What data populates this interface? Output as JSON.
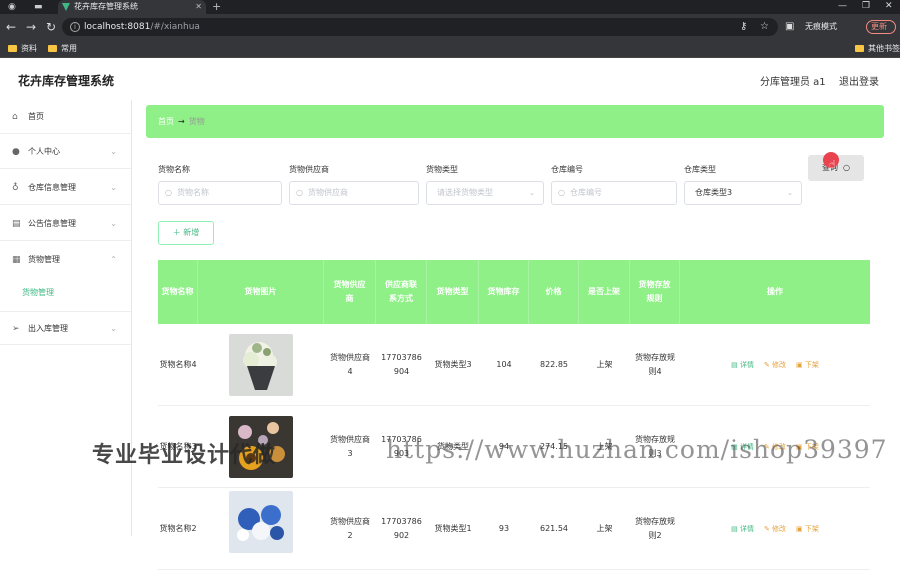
{
  "browser": {
    "tab_title": "花卉库存管理系统",
    "url_host": "localhost:8081",
    "url_path": "/#/xianhua",
    "incognito_label": "无痕模式",
    "update_label": "更新",
    "bookmarks": [
      "资料",
      "常用"
    ],
    "other_bookmarks": "其他书签"
  },
  "app": {
    "title": "花卉库存管理系统",
    "user_role": "分库管理员 a1",
    "logout": "退出登录"
  },
  "sidebar": {
    "items": [
      {
        "label": "首页",
        "icon": "home-icon"
      },
      {
        "label": "个人中心",
        "icon": "user-icon"
      },
      {
        "label": "仓库信息管理",
        "icon": "mic-icon"
      },
      {
        "label": "公告信息管理",
        "icon": "notice-icon"
      },
      {
        "label": "货物管理",
        "icon": "clipboard-icon"
      },
      {
        "label": "出入库管理",
        "icon": "send-icon"
      }
    ],
    "sub_item": "货物管理"
  },
  "breadcrumb": {
    "home": "首页",
    "arrow": "→",
    "current": "货物"
  },
  "filters": {
    "goods_name_label": "货物名称",
    "goods_name_placeholder": "货物名称",
    "supplier_label": "货物供应商",
    "supplier_placeholder": "货物供应商",
    "type_label": "货物类型",
    "type_placeholder": "请选择货物类型",
    "warehouse_no_label": "仓库编号",
    "warehouse_no_placeholder": "仓库编号",
    "warehouse_type_label": "仓库类型",
    "warehouse_type_value": "仓库类型3"
  },
  "buttons": {
    "search": "查询",
    "add": "＋ 新增"
  },
  "table": {
    "headers": [
      "货物名称",
      "货物图片",
      "货物供应商",
      "供应商联系方式",
      "货物类型",
      "货物库存",
      "价格",
      "是否上架",
      "货物存放规则",
      "操作"
    ],
    "rows": [
      {
        "name": "货物名称4",
        "supplier": "货物供应商4",
        "phone": "17703786904",
        "type": "货物类型3",
        "stock": "104",
        "price": "822.85",
        "listed": "上架",
        "rule": "货物存放规则4"
      },
      {
        "name": "货物名称3",
        "supplier": "货物供应商3",
        "phone": "17703786903",
        "type": "货物类型",
        "stock": "94",
        "price": "274.15",
        "listed": "上架",
        "rule": "货物存放规则3"
      },
      {
        "name": "货物名称2",
        "supplier": "货物供应商2",
        "phone": "17703786902",
        "type": "货物类型1",
        "stock": "93",
        "price": "621.54",
        "listed": "上架",
        "rule": "货物存放规则2"
      }
    ],
    "actions": {
      "detail": "详情",
      "edit": "修改",
      "off": "下架"
    }
  },
  "watermark": {
    "cn": "专业毕业设计代做",
    "url": "https://www.huzhan.com/ishop39397"
  },
  "colors": {
    "accent_green": "#8ef086",
    "text_green": "#41b883",
    "warning": "#e6a23c"
  }
}
